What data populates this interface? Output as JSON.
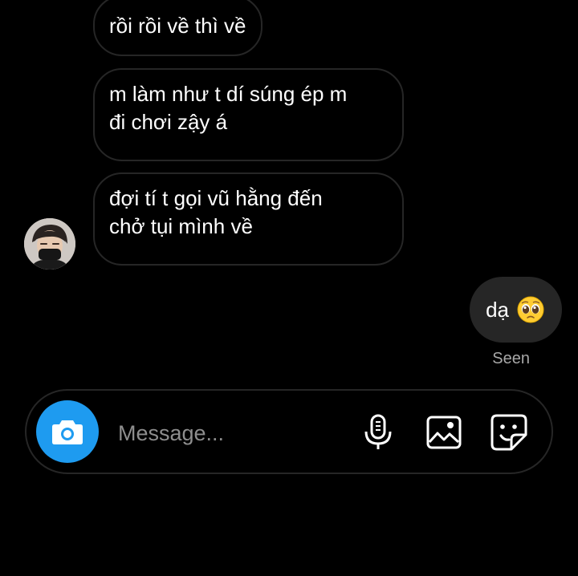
{
  "messages": [
    {
      "direction": "incoming",
      "text": "rồi rồi về thì về"
    },
    {
      "direction": "incoming",
      "text": "m làm như t dí súng ép m\nđi chơi zậy á"
    },
    {
      "direction": "incoming",
      "text": "đợi tí t gọi vũ hằng đến\nchở tụi mình về"
    },
    {
      "direction": "outgoing",
      "text": "dạ",
      "emoji": "pleading-face-icon"
    }
  ],
  "seen_label": "Seen",
  "composer": {
    "placeholder": "Message...",
    "value": ""
  },
  "icons": {
    "camera": "camera-icon",
    "mic": "microphone-icon",
    "gallery": "image-gallery-icon",
    "sticker": "sticker-icon"
  },
  "colors": {
    "background": "#000000",
    "incoming_border": "#262626",
    "outgoing_bubble": "#262626",
    "camera_button": "#1e9bf0",
    "seen_text": "#a8a8a8",
    "placeholder_text": "#8e8e8e"
  }
}
